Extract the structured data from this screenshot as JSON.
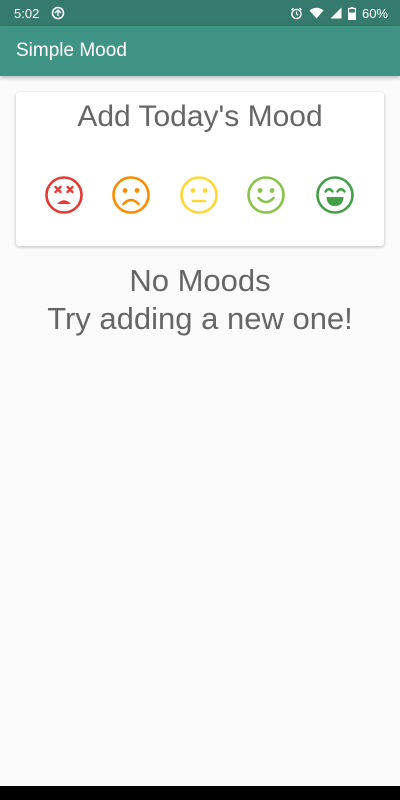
{
  "status_bar": {
    "time": "5:02",
    "battery": "60%"
  },
  "app_bar": {
    "title": "Simple Mood"
  },
  "card": {
    "title": "Add Today's Mood",
    "moods": [
      {
        "icon": "dead-face-icon",
        "color": "#e53935"
      },
      {
        "icon": "sad-face-icon",
        "color": "#fb8c00"
      },
      {
        "icon": "neutral-face-icon",
        "color": "#fdd835"
      },
      {
        "icon": "smile-face-icon",
        "color": "#8bc34a"
      },
      {
        "icon": "grin-face-icon",
        "color": "#43a047"
      }
    ]
  },
  "empty_state": {
    "line1": "No Moods",
    "line2": "Try adding a new one!"
  },
  "colors": {
    "status_bar": "#357a6c",
    "app_bar": "#409485",
    "background": "#fafafa"
  }
}
